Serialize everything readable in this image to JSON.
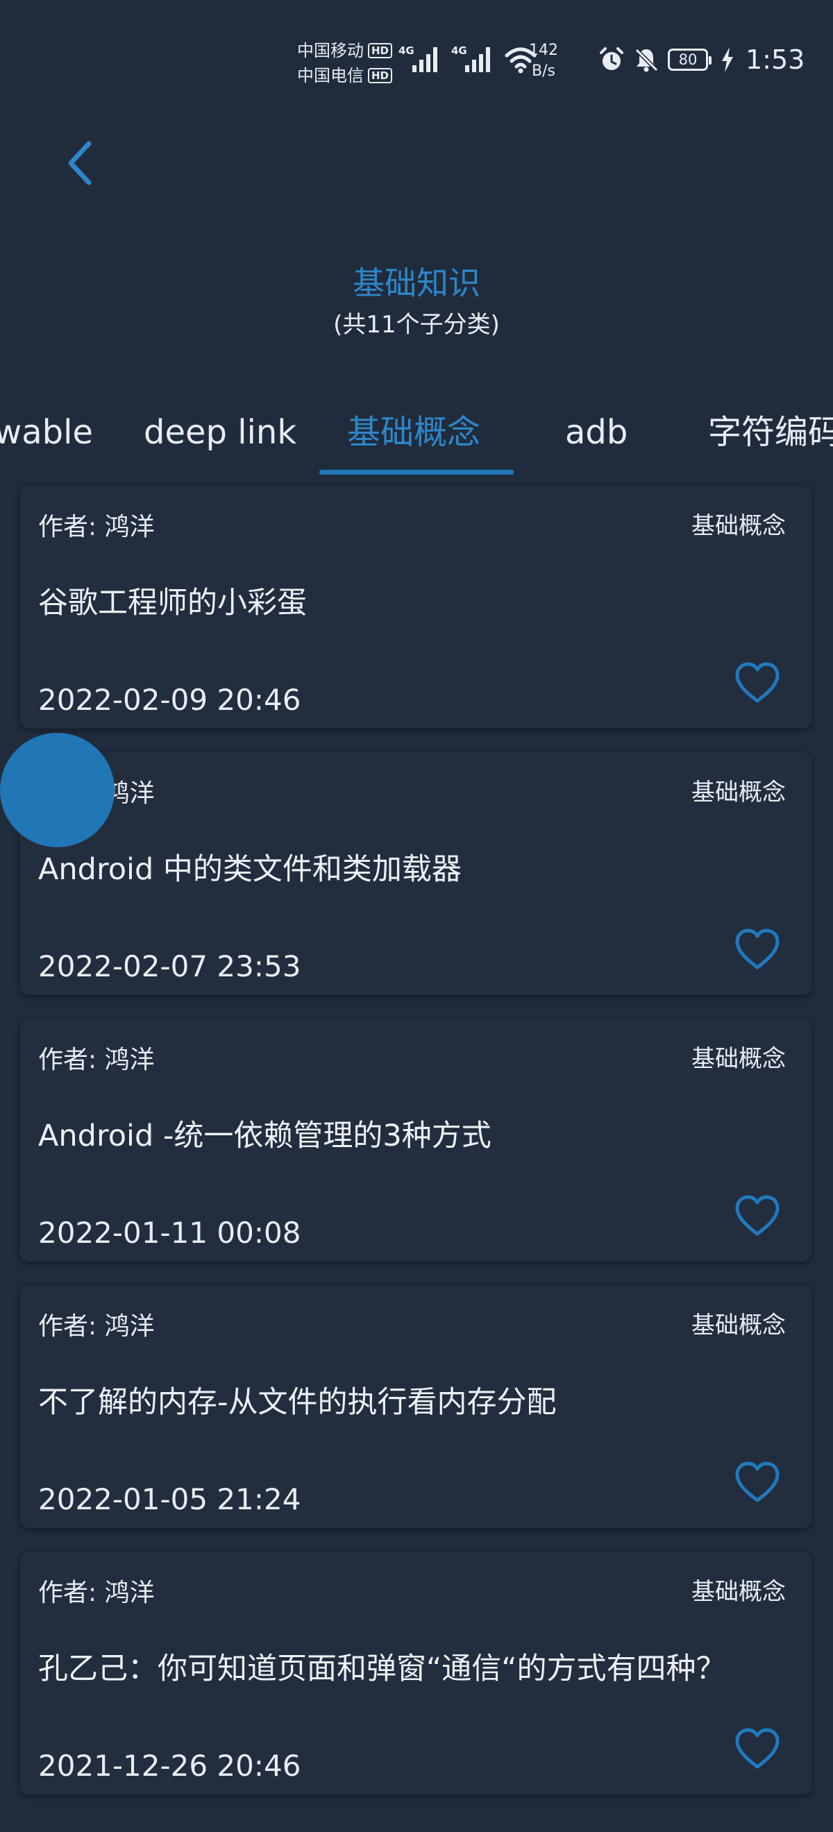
{
  "colors": {
    "background": "#202c3c",
    "card_background": "#222d3e",
    "accent": "#2e86c8",
    "text": "#e9edf2"
  },
  "status_bar": {
    "carrier1": "中国移动",
    "carrier2": "中国电信",
    "hd_label": "HD",
    "network1": "4G",
    "network2": "4G",
    "net_speed_value": "142",
    "net_speed_unit": "B/s",
    "battery_level": "80",
    "time": "1:53",
    "icons": [
      "alarm-icon",
      "mute-bell-icon",
      "battery-icon",
      "charging-icon",
      "wifi-icon",
      "signal-icon"
    ]
  },
  "header": {
    "back_icon": "chevron-left-icon",
    "title": "基础知识",
    "subtitle": "(共11个子分类)"
  },
  "tabs": [
    {
      "label": "wable",
      "active": false
    },
    {
      "label": "deep link",
      "active": false
    },
    {
      "label": "基础概念",
      "active": true
    },
    {
      "label": "adb",
      "active": false
    },
    {
      "label": "字符编码",
      "active": false
    }
  ],
  "articles": [
    {
      "author": "作者: 鸿洋",
      "category": "基础概念",
      "title": "谷歌工程师的小彩蛋",
      "date": "2022-02-09 20:46",
      "favorited": false
    },
    {
      "author": "作者: 鸿洋",
      "category": "基础概念",
      "title": "Android 中的类文件和类加载器",
      "date": "2022-02-07 23:53",
      "favorited": false
    },
    {
      "author": "作者: 鸿洋",
      "category": "基础概念",
      "title": "Android -统一依赖管理的3种方式",
      "date": "2022-01-11 00:08",
      "favorited": false
    },
    {
      "author": "作者: 鸿洋",
      "category": "基础概念",
      "title": "不了解的内存-从文件的执行看内存分配",
      "date": "2022-01-05 21:24",
      "favorited": false
    },
    {
      "author": "作者: 鸿洋",
      "category": "基础概念",
      "title": "孔乙己：你可知道页面和弹窗“通信“的方式有四种？",
      "date": "2021-12-26 20:46",
      "favorited": false
    }
  ]
}
